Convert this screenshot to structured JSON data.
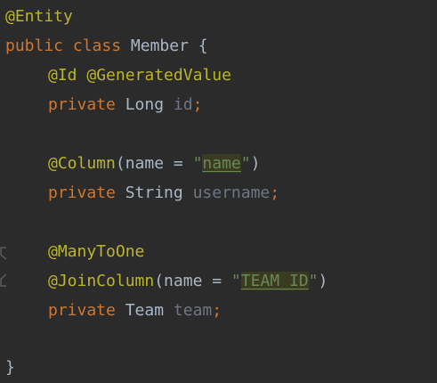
{
  "code": {
    "l1": {
      "annotation": "@Entity"
    },
    "l2": {
      "kw_public": "public",
      "kw_class": "class",
      "class_name": "Member",
      "brace": "{"
    },
    "l3": {
      "annotation_id": "@Id",
      "annotation_gen": "@GeneratedValue"
    },
    "l4": {
      "kw": "private",
      "type": "Long",
      "field": "id",
      "semi": ";"
    },
    "l6": {
      "annotation": "@Column",
      "open": "(name = ",
      "quote_open": "\"",
      "value": "name",
      "quote_close": "\"",
      "close": ")"
    },
    "l7": {
      "kw": "private",
      "type": "String",
      "field": "username",
      "semi": ";"
    },
    "l9": {
      "annotation": "@ManyToOne"
    },
    "l10": {
      "annotation": "@JoinColumn",
      "open": "(name = ",
      "quote_open": "\"",
      "value": "TEAM_ID",
      "quote_close": "\"",
      "close": ")"
    },
    "l11": {
      "kw": "private",
      "type": "Team",
      "field": "team",
      "semi": ";"
    },
    "l13": {
      "brace": "}"
    }
  }
}
